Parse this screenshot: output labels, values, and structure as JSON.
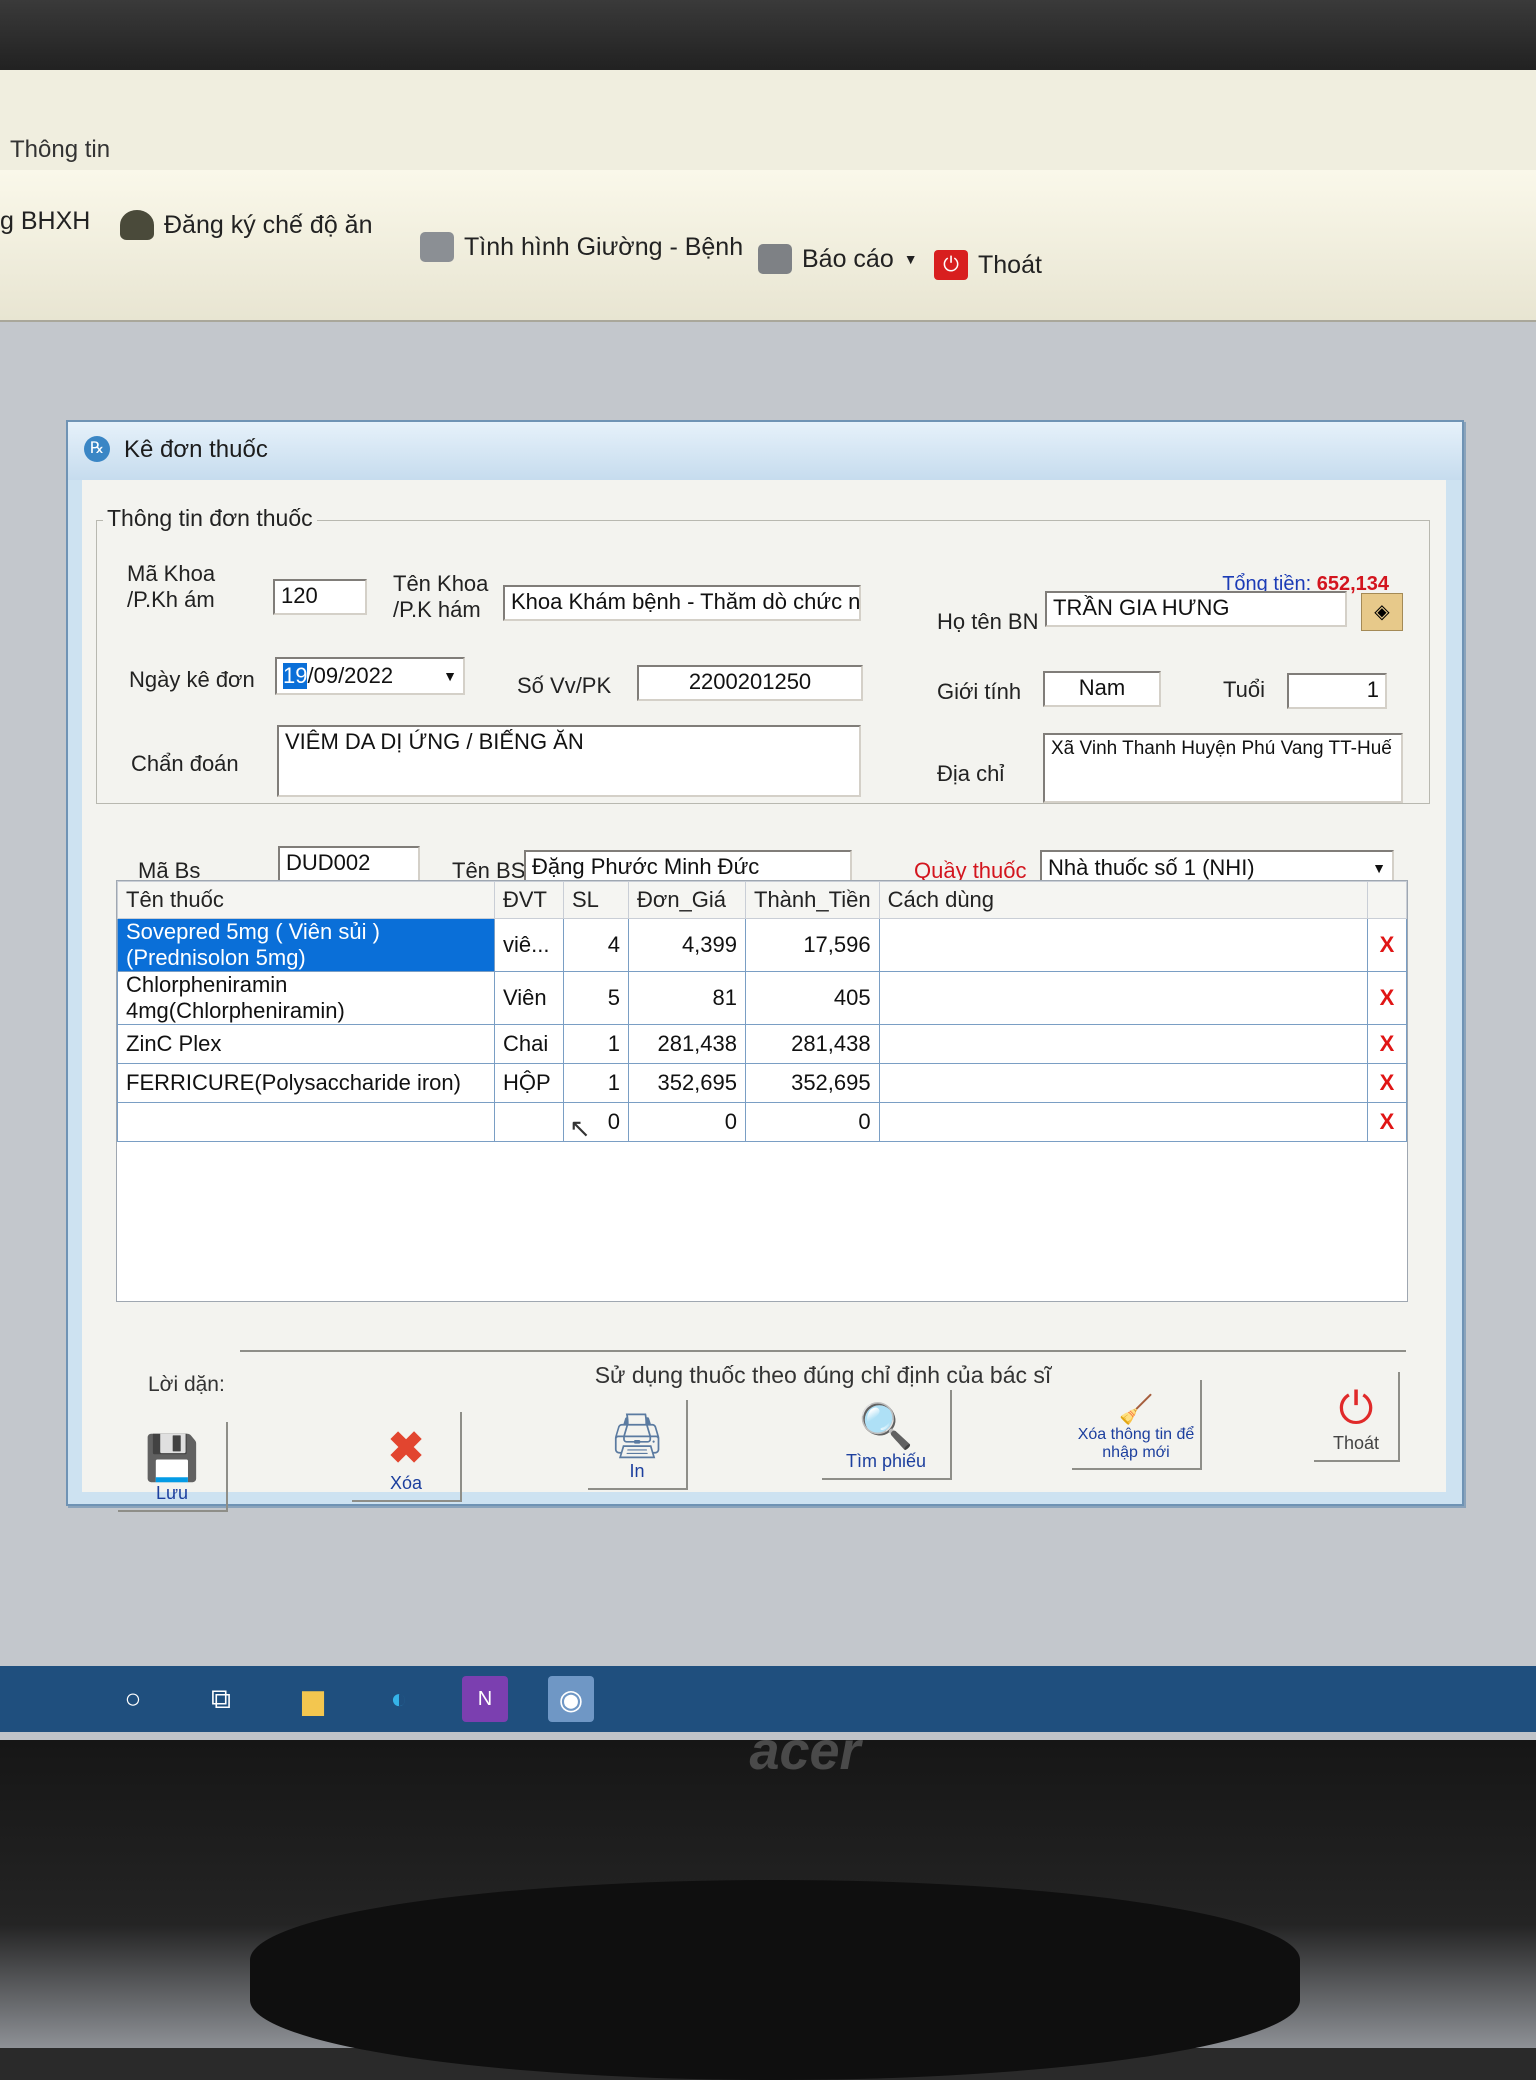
{
  "menubar": {
    "thong_tin": "Thông tin"
  },
  "toolbar": {
    "bhxh": "g BHXH",
    "dang_ky": "Đăng ký chế độ ăn",
    "tinh_hinh": "Tình hình Giường - Bệnh",
    "bao_cao": "Báo cáo",
    "thoat": "Thoát"
  },
  "dialog": {
    "title": "Kê đơn thuốc",
    "group_title": "Thông tin đơn thuốc",
    "total_label": "Tổng tiền:",
    "total_value": "652,134",
    "labels": {
      "ma_khoa": "Mã Khoa /P.Kh ám",
      "ten_khoa": "Tên Khoa /P.K hám",
      "ho_ten": "Họ tên BN",
      "ngay_ke_don": "Ngày kê đơn",
      "so_vv": "Số Vv/PK",
      "gioi_tinh": "Giới tính",
      "tuoi": "Tuổi",
      "chan_doan": "Chẩn đoán",
      "dia_chi": "Địa chỉ",
      "ma_bs": "Mã Bs",
      "ten_bs": "Tên BS",
      "quay_thuoc": "Quầy thuốc"
    },
    "values": {
      "ma_khoa": "120",
      "ten_khoa": "Khoa Khám bệnh - Thăm dò chức n",
      "ho_ten": "TRẦN GIA HƯNG",
      "ngay_ke_don_sel": "19",
      "ngay_ke_don_rest": "/09/2022",
      "so_vv": "2200201250",
      "gioi_tinh": "Nam",
      "tuoi": "1",
      "chan_doan": "VIÊM DA DỊ ỨNG / BIẾNG ĂN",
      "dia_chi": "Xã Vinh Thanh Huyện Phú Vang TT-Huế",
      "ma_bs": "DUD002",
      "ten_bs": "Đặng Phước Minh Đức",
      "quay_thuoc": "Nhà thuốc số 1 (NHI)"
    },
    "grid": {
      "headers": [
        "Tên thuốc",
        "ĐVT",
        "SL",
        "Đơn_Giá",
        "Thành_Tiền",
        "Cách dùng"
      ],
      "rows": [
        {
          "ten": "Sovepred 5mg ( Viên sủi )(Prednisolon 5mg)",
          "dvt": "viê...",
          "sl": "4",
          "don_gia": "4,399",
          "thanh_tien": "17,596",
          "cach_dung": "",
          "del": "X"
        },
        {
          "ten": "Chlorpheniramin 4mg(Chlorpheniramin)",
          "dvt": "Viên",
          "sl": "5",
          "don_gia": "81",
          "thanh_tien": "405",
          "cach_dung": "",
          "del": "X"
        },
        {
          "ten": "ZinC Plex",
          "dvt": "Chai",
          "sl": "1",
          "don_gia": "281,438",
          "thanh_tien": "281,438",
          "cach_dung": "",
          "del": "X"
        },
        {
          "ten": "FERRICURE(Polysaccharide iron)",
          "dvt": "HỘP",
          "sl": "1",
          "don_gia": "352,695",
          "thanh_tien": "352,695",
          "cach_dung": "",
          "del": "X"
        },
        {
          "ten": "",
          "dvt": "",
          "sl": "0",
          "don_gia": "0",
          "thanh_tien": "0",
          "cach_dung": "",
          "del": "X"
        }
      ]
    },
    "loi_dan_label": "Lời dặn:",
    "loi_dan": "Sử dụng thuốc theo đúng chỉ định của bác sĩ",
    "buttons": {
      "luu": "Lưu",
      "xoa": "Xóa",
      "in": "In",
      "tim_phieu": "Tìm phiếu",
      "xoa_thong_tin": "Xóa thông tin để nhập mới",
      "thoat": "Thoát"
    }
  },
  "monitor": {
    "brand": "acer"
  },
  "colors": {
    "accent_red": "#d3151e",
    "selection": "#0a6fd8",
    "link_blue": "#1c3f9e"
  }
}
